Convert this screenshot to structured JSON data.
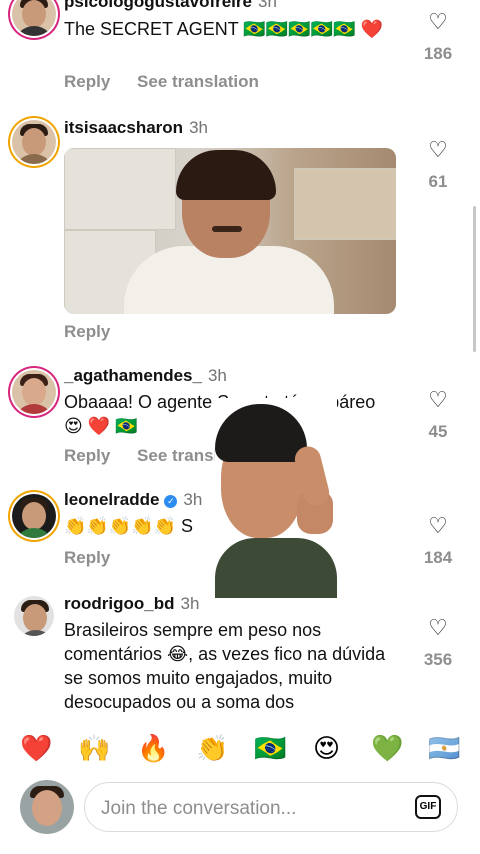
{
  "comments": [
    {
      "username": "psicologogustavofreire",
      "time": "3h",
      "text": "The SECRET AGENT 🇧🇷🇧🇷🇧🇷🇧🇷🇧🇷 ❤️",
      "actions": [
        "Reply",
        "See translation"
      ],
      "likes": "186"
    },
    {
      "username": "itsisaacsharon",
      "time": "3h",
      "text": "",
      "actions": [
        "Reply"
      ],
      "likes": "61"
    },
    {
      "username": "_agathamendes_",
      "time": "3h",
      "text": "Obaaaa! O agente Secreto tá no páreo 😍 ❤️ 🇧🇷",
      "actions": [
        "Reply",
        "See translation"
      ],
      "likes": "45"
    },
    {
      "username": "leonelradde",
      "time": "3h",
      "text": "👏👏👏👏👏 S",
      "actions": [
        "Reply"
      ],
      "likes": "184"
    },
    {
      "username": "roodrigoo_bd",
      "time": "3h",
      "text": "Brasileiros sempre em peso nos comentários 😂, as vezes fico na dúvida se somos muito engajados, muito desocupados ou a soma dos",
      "actions": [],
      "likes": "356"
    }
  ],
  "emoji_bar": [
    "❤️",
    "🙌",
    "🔥",
    "👏",
    "🇧🇷",
    "😍",
    "💚",
    "🇦🇷"
  ],
  "composer": {
    "placeholder": "Join the conversation...",
    "gif_label": "GIF"
  },
  "icons": {
    "heart": "heart-icon",
    "verified": "verified-badge-icon",
    "gif": "gif-icon"
  }
}
